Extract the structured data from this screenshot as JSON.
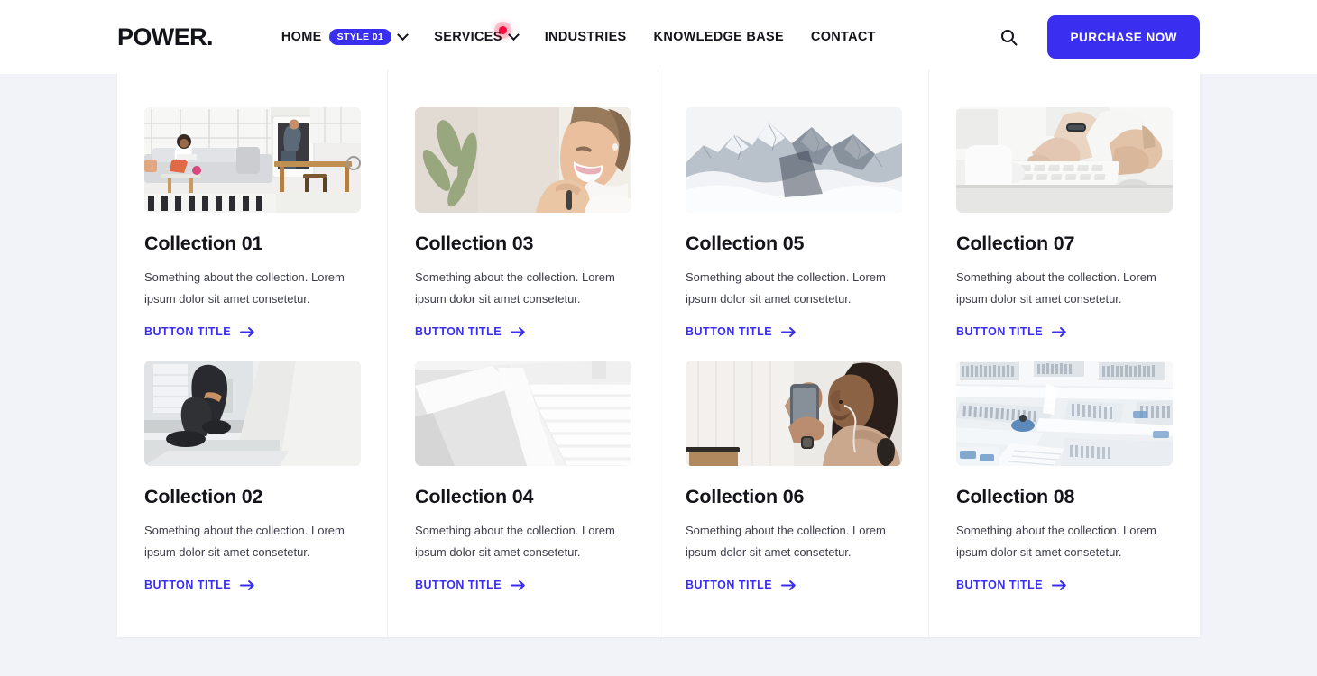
{
  "header": {
    "logo": "POWER.",
    "nav": [
      {
        "label": "HOME",
        "badge": "STYLE 01",
        "has_chevron": true,
        "has_dot": false,
        "icon": "chevron-down-icon"
      },
      {
        "label": "SERVICES",
        "badge": "",
        "has_chevron": true,
        "has_dot": true,
        "icon": "chevron-down-icon"
      },
      {
        "label": "INDUSTRIES",
        "badge": "",
        "has_chevron": false,
        "has_dot": false,
        "icon": ""
      },
      {
        "label": "KNOWLEDGE BASE",
        "badge": "",
        "has_chevron": false,
        "has_dot": false,
        "icon": ""
      },
      {
        "label": "CONTACT",
        "badge": "",
        "has_chevron": false,
        "has_dot": false,
        "icon": ""
      }
    ],
    "search_icon": "search-icon",
    "purchase_label": "PURCHASE NOW"
  },
  "colors": {
    "accent": "#3a2ff0",
    "dot": "#f5093c",
    "page_bg": "#f2f3f8",
    "panel_bg": "#ffffff",
    "text": "#13131a",
    "divider": "#eceef3"
  },
  "columns": [
    {
      "cards": [
        {
          "title": "Collection 01",
          "desc": "Something about the collection. Lorem ipsum dolor sit amet consetetur.",
          "link": "BUTTON TITLE",
          "image_alt": "living-room-interior-woman-on-sofa"
        },
        {
          "title": "Collection 02",
          "desc": "Something about the collection. Lorem ipsum dolor sit amet consetetur.",
          "link": "BUTTON TITLE",
          "image_alt": "legs-walking-down-white-steps"
        }
      ]
    },
    {
      "cards": [
        {
          "title": "Collection 03",
          "desc": "Something about the collection. Lorem ipsum dolor sit amet consetetur.",
          "link": "BUTTON TITLE",
          "image_alt": "smiling-woman-portrait-with-plant"
        },
        {
          "title": "Collection 04",
          "desc": "Something about the collection. Lorem ipsum dolor sit amet consetetur.",
          "link": "BUTTON TITLE",
          "image_alt": "white-minimal-staircase"
        }
      ]
    },
    {
      "cards": [
        {
          "title": "Collection 05",
          "desc": "Something about the collection. Lorem ipsum dolor sit amet consetetur.",
          "link": "BUTTON TITLE",
          "image_alt": "snowy-mountain-peaks-in-clouds"
        },
        {
          "title": "Collection 06",
          "desc": "Something about the collection. Lorem ipsum dolor sit amet consetetur.",
          "link": "BUTTON TITLE",
          "image_alt": "woman-holding-phone-with-earphones"
        }
      ]
    },
    {
      "cards": [
        {
          "title": "Collection 07",
          "desc": "Something about the collection. Lorem ipsum dolor sit amet consetetur.",
          "link": "BUTTON TITLE",
          "image_alt": "hands-typing-on-keyboard-with-mug"
        },
        {
          "title": "Collection 08",
          "desc": "Something about the collection. Lorem ipsum dolor sit amet consetetur.",
          "link": "BUTTON TITLE",
          "image_alt": "modern-white-library-interior"
        }
      ]
    }
  ]
}
